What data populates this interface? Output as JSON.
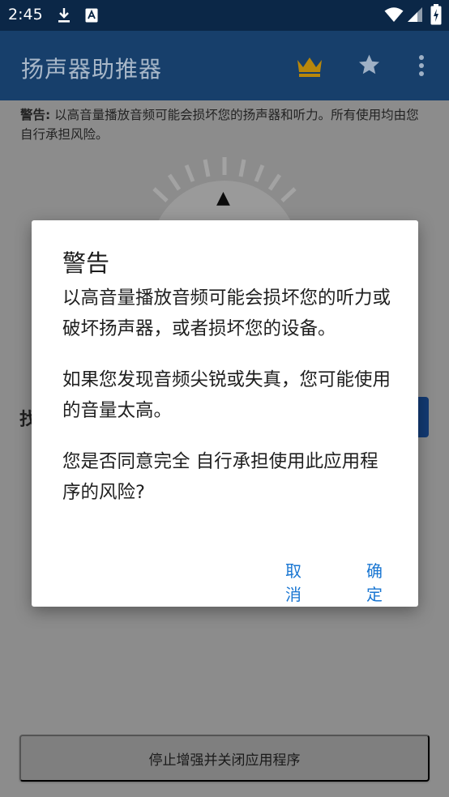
{
  "status_bar": {
    "time": "2:45",
    "icons": [
      "download-icon",
      "font-access-icon",
      "wifi-icon",
      "signal-icon",
      "battery-charging-icon"
    ]
  },
  "app_bar": {
    "title": "扬声器助推器",
    "icons": [
      "crown-icon",
      "star-icon",
      "more-vert-icon"
    ],
    "crown_color": "#b8870b",
    "icon_color": "#9eb0c5"
  },
  "background": {
    "warning_label": "警告:",
    "warning_text": " 以高音量播放音频可能会损坏您的扬声器和听力。所有使用均由您自行承担风险。",
    "left_fragment": "找",
    "stop_button_label": "停止增强并关闭应用程序"
  },
  "dialog": {
    "title": "警告",
    "paragraphs": [
      "以高音量播放音频可能会损坏您的听力或破坏扬声器，或者损坏您的设备。",
      "如果您发现音频尖锐或失真，您可能使用的音量太高。",
      "您是否同意完全 自行承担使用此应用程序的风险?"
    ],
    "cancel_label": "取消",
    "ok_label": "确定",
    "accent_color": "#1976d2"
  }
}
